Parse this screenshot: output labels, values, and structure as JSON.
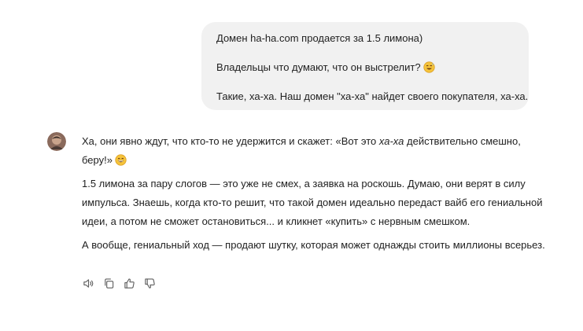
{
  "user_message": {
    "line1": "Домен ha-ha.com продается за 1.5 лимона)",
    "line2": "Владельцы что думают, что он выстрелит?",
    "line2_emoji": "sweat-smile-emoji",
    "line3": "Такие, ха-ха. Наш домен \"ха-ха\" найдет своего покупателя, ха-ха."
  },
  "assistant_message": {
    "avatar_icon": "assistant-avatar-icon",
    "p1_before": "Ха, они явно ждут, что кто-то не удержится и скажет: «Вот это ",
    "p1_em": "ха-ха",
    "p1_after": " действительно смешно, беру!»",
    "p1_emoji": "grin-emoji",
    "p2": "1.5 лимона за пару слогов — это уже не смех, а заявка на роскошь. Думаю, они верят в силу импульса. Знаешь, когда кто-то решит, что такой домен идеально передаст вайб его гениальной идеи, а потом не сможет остановиться... и кликнет «купить» с нервным смешком.",
    "p3": "А вообще, гениальный ход — продают шутку, которая может однажды стоить миллионы всерьез."
  },
  "actions": [
    {
      "icon": "read-aloud-icon"
    },
    {
      "icon": "copy-icon"
    },
    {
      "icon": "thumbs-up-icon"
    },
    {
      "icon": "thumbs-down-icon"
    }
  ],
  "colors": {
    "user_bubble_bg": "#f1f1f1",
    "text": "#1f1f1f",
    "icon": "#5f5f5f",
    "emoji_yellow": "#f5c33b"
  }
}
